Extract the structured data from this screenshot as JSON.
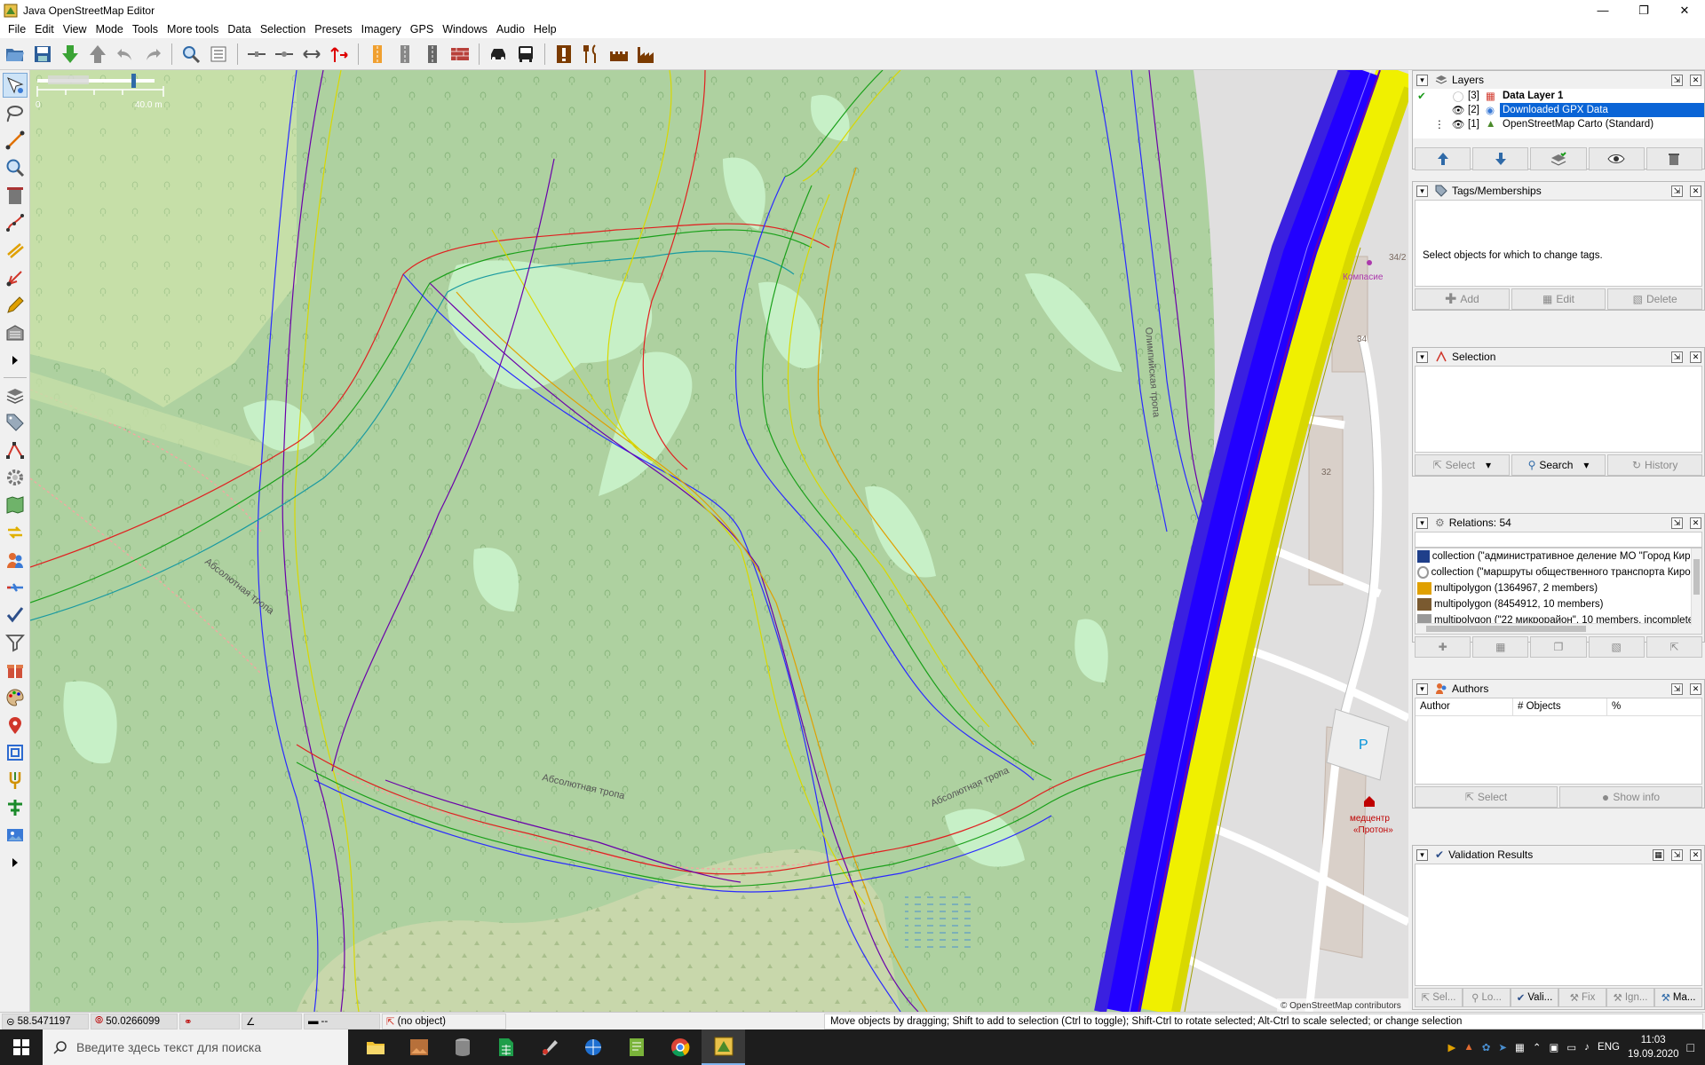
{
  "window": {
    "title": "Java OpenStreetMap Editor"
  },
  "menu": [
    "File",
    "Edit",
    "View",
    "Mode",
    "Tools",
    "More tools",
    "Data",
    "Selection",
    "Presets",
    "Imagery",
    "GPS",
    "Windows",
    "Audio",
    "Help"
  ],
  "map": {
    "scale_start": "0",
    "scale_end": "40.0 m",
    "street_labels": [
      "Абсолютная тропа",
      "Абсолютная тропа",
      "Абсолютная тропа",
      "Олимпийская тропа"
    ],
    "house_numbers": [
      "34",
      "32",
      "34/2"
    ],
    "poi_medcenter": [
      "медцентр",
      "«Протон»"
    ],
    "poi_kompasie": "Компасие",
    "parking": "P",
    "attribution": "© OpenStreetMap contributors",
    "colors": {
      "forest": "#aed1a0",
      "meadow": "#cdebb0",
      "clearing": "#c7f0c7",
      "urban": "#e0dfdf",
      "building": "#d9d0c9",
      "road": "#ffffff",
      "rail_dash": "#e87070",
      "track_blue": "#2200ff",
      "track_yellow": "#f0f000"
    }
  },
  "layers_panel": {
    "title": "Layers",
    "rows": [
      {
        "num": "[3]",
        "name": "Data Layer 1",
        "selected": false
      },
      {
        "num": "[2]",
        "name": "Downloaded GPX Data",
        "selected": true
      },
      {
        "num": "[1]",
        "name": "OpenStreetMap Carto (Standard)",
        "selected": false
      }
    ]
  },
  "tags_panel": {
    "title": "Tags/Memberships",
    "empty_msg": "Select objects for which to change tags.",
    "add": "Add",
    "edit": "Edit",
    "delete": "Delete"
  },
  "selection_panel": {
    "title": "Selection",
    "select": "Select",
    "search": "Search",
    "history": "History"
  },
  "relations_panel": {
    "title": "Relations: 54",
    "items": [
      "collection (\"административное деление МО \"Город Киров",
      "collection (\"маршруты общественного транспорта Кирова",
      "multipolygon (1364967, 2 members)",
      "multipolygon (8454912, 10 members)",
      "multipolygon (\"22 микрорайон\", 10 members, incomplete)"
    ]
  },
  "authors_panel": {
    "title": "Authors",
    "columns": [
      "Author",
      "# Objects",
      "%"
    ],
    "select": "Select",
    "show_info": "Show info"
  },
  "validation_panel": {
    "title": "Validation Results",
    "tabs": [
      "Sel...",
      "Lo...",
      "Vali...",
      "Fix",
      "Ign...",
      "Ma..."
    ]
  },
  "status": {
    "lat": "58.5471197",
    "lon": "50.0266099",
    "heading": "",
    "angle": "",
    "length": "--",
    "object": "(no object)",
    "message": "Move objects by dragging; Shift to add to selection (Ctrl to toggle); Shift-Ctrl to rotate selected; Alt-Ctrl to scale selected; or change selection"
  },
  "taskbar": {
    "search_placeholder": "Введите здесь текст для поиска",
    "lang": "ENG",
    "time": "11:03",
    "date": "19.09.2020"
  }
}
